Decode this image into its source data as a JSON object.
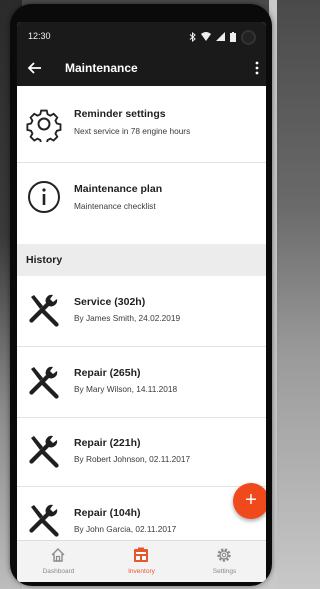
{
  "status_bar": {
    "time": "12:30"
  },
  "app_bar": {
    "title": "Maintenance"
  },
  "menu_items": [
    {
      "title": "Reminder settings",
      "subtitle": "Next service in 78 engine hours",
      "icon": "gear-icon"
    },
    {
      "title": "Maintenance plan",
      "subtitle": "Maintenance checklist",
      "icon": "info-icon"
    }
  ],
  "history": {
    "header": "History",
    "items": [
      {
        "title": "Service (302h)",
        "subtitle": "By James Smith, 24.02.2019",
        "icon": "wrench-tools-icon"
      },
      {
        "title": "Repair (265h)",
        "subtitle": "By Mary Wilson, 14.11.2018",
        "icon": "wrench-tools-icon"
      },
      {
        "title": "Repair (221h)",
        "subtitle": "By Robert Johnson, 02.11.2017",
        "icon": "wrench-tools-icon"
      },
      {
        "title": "Repair (104h)",
        "subtitle": "By John Garcia, 02.11.2017",
        "icon": "wrench-tools-icon"
      }
    ]
  },
  "fab": {
    "label": "+"
  },
  "bottom_nav": [
    {
      "label": "Dashboard",
      "icon": "home-icon",
      "active": false
    },
    {
      "label": "Inventory",
      "icon": "inventory-icon",
      "active": true
    },
    {
      "label": "Settings",
      "icon": "gear-icon",
      "active": false
    }
  ],
  "colors": {
    "accent": "#f04a1c",
    "bar": "#1a1a1a",
    "section_bg": "#ececec"
  }
}
